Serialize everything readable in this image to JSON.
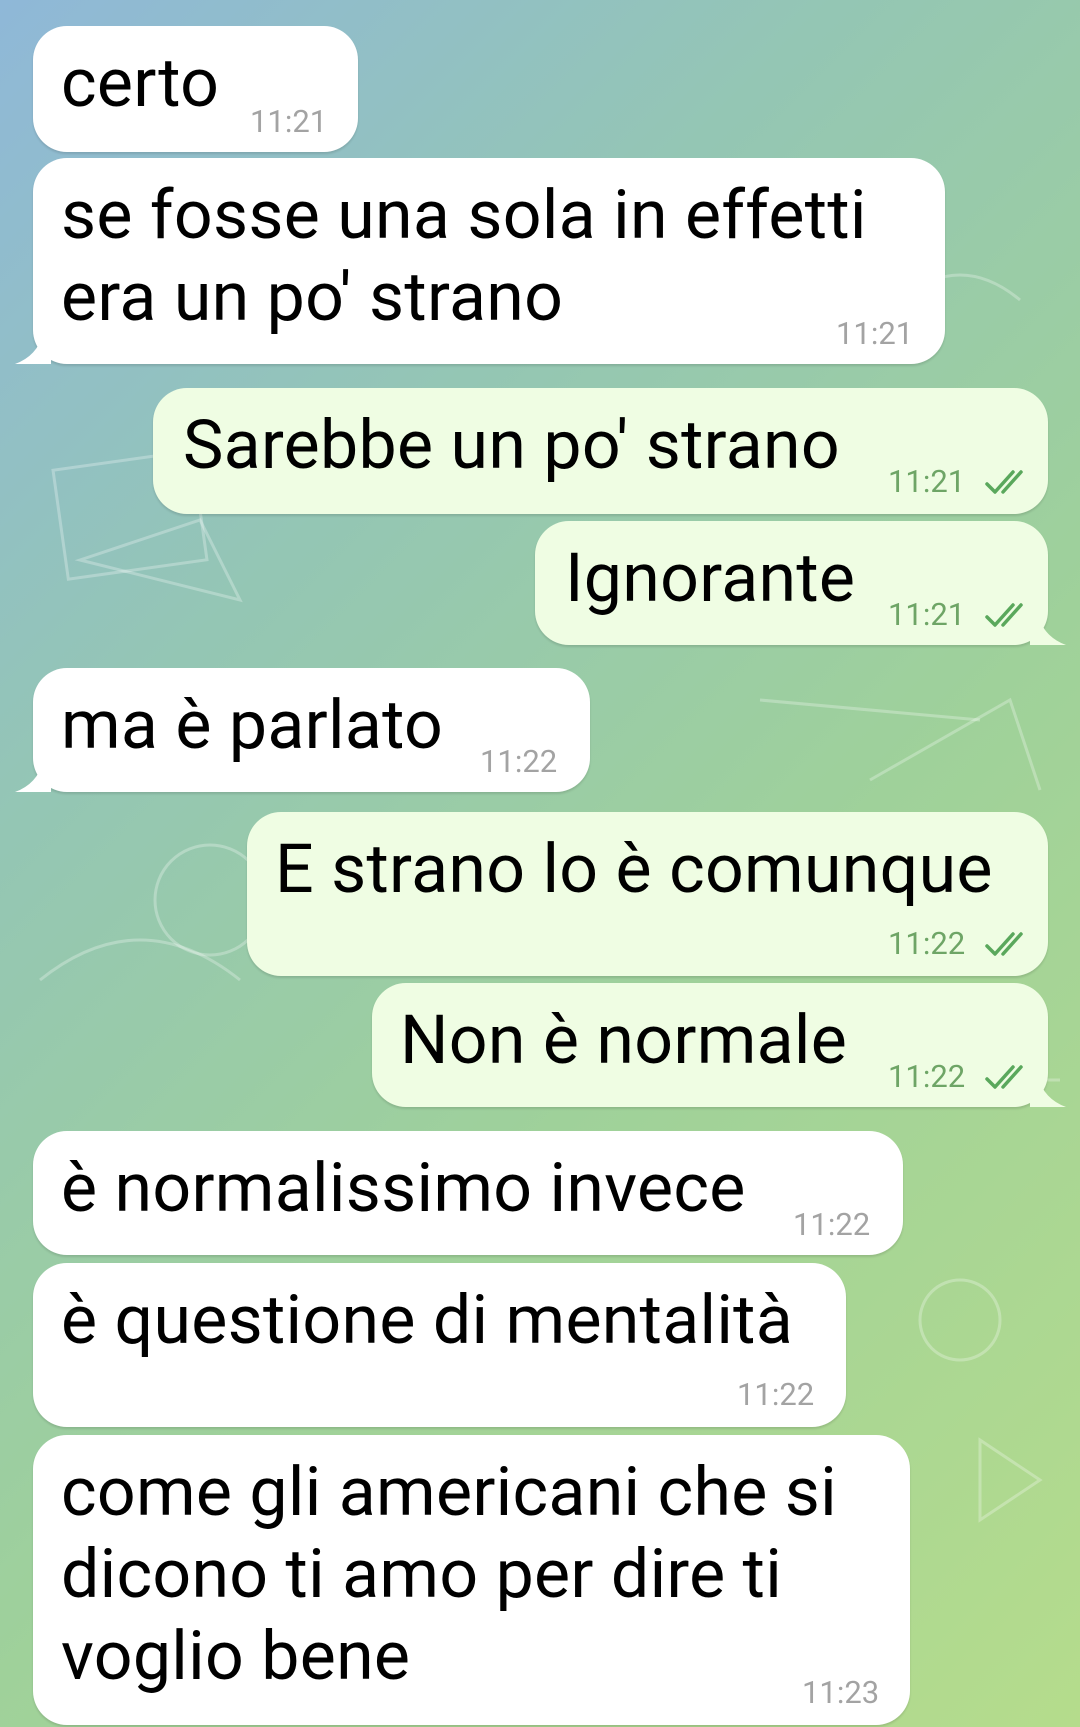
{
  "colors": {
    "incoming_bubble": "#ffffff",
    "outgoing_bubble": "#effde3",
    "read_check": "#5aa85c"
  },
  "messages": [
    {
      "direction": "in",
      "text": "certo",
      "time": "11:21"
    },
    {
      "direction": "in",
      "text": "se fosse una sola in effetti\nera un po' strano",
      "time": "11:21"
    },
    {
      "direction": "out",
      "text": "Sarebbe un po' strano",
      "time": "11:21",
      "status": "read-double-check-icon"
    },
    {
      "direction": "out",
      "text": "Ignorante",
      "time": "11:21",
      "status": "read-double-check-icon"
    },
    {
      "direction": "in",
      "text": "ma è parlato",
      "time": "11:22"
    },
    {
      "direction": "out",
      "text": "E strano lo è comunque",
      "time": "11:22",
      "status": "read-double-check-icon"
    },
    {
      "direction": "out",
      "text": "Non è normale",
      "time": "11:22",
      "status": "read-double-check-icon"
    },
    {
      "direction": "in",
      "text": "è normalissimo invece",
      "time": "11:22"
    },
    {
      "direction": "in",
      "text": "è questione di mentalità",
      "time": "11:22"
    },
    {
      "direction": "in",
      "text": "come gli americani che si\ndicono ti amo per dire ti\nvoglio bene",
      "time": "11:23"
    }
  ]
}
